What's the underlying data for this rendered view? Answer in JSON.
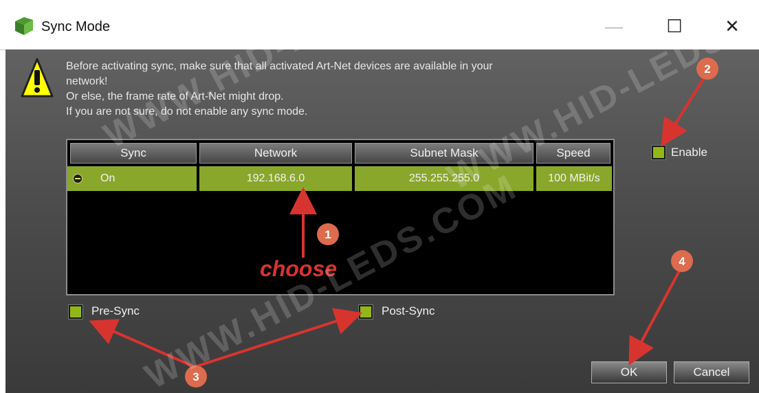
{
  "window": {
    "title": "Sync Mode",
    "controls": {
      "minimize": "—",
      "maximize": "☐",
      "close": "✕"
    }
  },
  "warning": {
    "icon": "warning-icon",
    "lines": [
      "Before activating sync, make sure that all activated Art-Net devices are available in your",
      "network!",
      "Or else, the frame rate of Art-Net might drop.",
      "If you are not sure, do not enable any sync mode."
    ]
  },
  "table": {
    "columns": [
      "Sync",
      "Network",
      "Subnet Mask",
      "Speed"
    ],
    "rows": [
      {
        "sync": "On",
        "network": "192.168.6.0",
        "subnet": "255.255.255.0",
        "speed": "100 MBit/s"
      }
    ]
  },
  "options": {
    "enable": {
      "label": "Enable",
      "checked": true
    },
    "pre_sync": {
      "label": "Pre-Sync",
      "checked": true
    },
    "post_sync": {
      "label": "Post-Sync",
      "checked": true
    }
  },
  "buttons": {
    "ok": "OK",
    "cancel": "Cancel"
  },
  "annotations": {
    "choose": "choose",
    "markers": [
      "1",
      "2",
      "3",
      "4"
    ]
  },
  "watermark": "WWW.HID-LEDS.COM",
  "colors": {
    "row_highlight": "#89a72b",
    "checkbox": "#92b817",
    "annotation_red": "#d8342f",
    "marker_orange": "#dd6b4d"
  }
}
